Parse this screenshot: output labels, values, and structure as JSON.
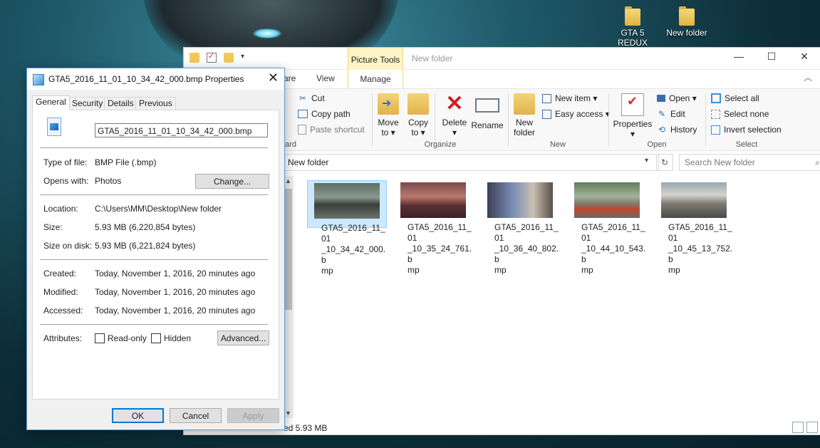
{
  "desktop": {
    "icons": [
      {
        "label": "GTA 5 REDUX"
      },
      {
        "label": "New folder"
      }
    ]
  },
  "explorer": {
    "window_title": "New folder",
    "context_tab": "Picture Tools",
    "tabs": {
      "share_partial": "are",
      "view": "View",
      "manage": "Manage"
    },
    "ribbon": {
      "clipboard": {
        "cut": "Cut",
        "copy_path": "Copy path",
        "paste_shortcut": "Paste shortcut",
        "label_partial": "ard"
      },
      "organize": {
        "move_to_line1": "Move",
        "move_to_line2": "to ▾",
        "copy_to_line1": "Copy",
        "copy_to_line2": "to ▾",
        "delete_line1": "Delete",
        "delete_line2": "▾",
        "rename": "Rename",
        "label": "Organize"
      },
      "new": {
        "new_folder_line1": "New",
        "new_folder_line2": "folder",
        "new_item": "New item ▾",
        "easy_access": "Easy access ▾",
        "label": "New"
      },
      "open": {
        "properties_line1": "Properties",
        "properties_line2": "▾",
        "open": "Open ▾",
        "edit": "Edit",
        "history": "History",
        "label": "Open"
      },
      "select": {
        "select_all": "Select all",
        "select_none": "Select none",
        "invert_selection": "Invert selection",
        "label": "Select"
      }
    },
    "address": "New folder",
    "search_placeholder": "Search New folder",
    "files": [
      {
        "name": "GTA5_2016_11_01_10_34_42_000.bmp",
        "label_l1": "GTA5_2016_11_01",
        "label_l2": "_10_34_42_000.b",
        "label_l3": "mp",
        "selected": true
      },
      {
        "name": "GTA5_2016_11_01_10_35_24_761.bmp",
        "label_l1": "GTA5_2016_11_01",
        "label_l2": "_10_35_24_761.b",
        "label_l3": "mp",
        "selected": false
      },
      {
        "name": "GTA5_2016_11_01_10_36_40_802.bmp",
        "label_l1": "GTA5_2016_11_01",
        "label_l2": "_10_36_40_802.b",
        "label_l3": "mp",
        "selected": false
      },
      {
        "name": "GTA5_2016_11_01_10_44_10_543.bmp",
        "label_l1": "GTA5_2016_11_01",
        "label_l2": "_10_44_10_543.b",
        "label_l3": "mp",
        "selected": false
      },
      {
        "name": "GTA5_2016_11_01_10_45_13_752.bmp",
        "label_l1": "GTA5_2016_11_01",
        "label_l2": "_10_45_13_752.b",
        "label_l3": "mp",
        "selected": false
      }
    ],
    "status": "ed  5.93 MB"
  },
  "properties": {
    "title": "GTA5_2016_11_01_10_34_42_000.bmp Properties",
    "tabs": [
      "General",
      "Security",
      "Details",
      "Previous Versions"
    ],
    "filename": "GTA5_2016_11_01_10_34_42_000.bmp",
    "type_label": "Type of file:",
    "type_value": "BMP File (.bmp)",
    "opens_label": "Opens with:",
    "opens_value": "Photos",
    "change_button": "Change...",
    "location_label": "Location:",
    "location_value": "C:\\Users\\MM\\Desktop\\New folder",
    "size_label": "Size:",
    "size_value": "5.93 MB (6,220,854 bytes)",
    "size_disk_label": "Size on disk:",
    "size_disk_value": "5.93 MB (6,221,824 bytes)",
    "created_label": "Created:",
    "created_value": "Today, November 1, 2016, 20 minutes ago",
    "modified_label": "Modified:",
    "modified_value": "Today, November 1, 2016, 20 minutes ago",
    "accessed_label": "Accessed:",
    "accessed_value": "Today, November 1, 2016, 20 minutes ago",
    "attributes_label": "Attributes:",
    "readonly_label": "Read-only",
    "hidden_label": "Hidden",
    "advanced_button": "Advanced...",
    "ok_button": "OK",
    "cancel_button": "Cancel",
    "apply_button": "Apply"
  },
  "colors": {
    "accent": "#0078d7",
    "selection_bg": "#cce8ff",
    "context_tab_bg": "#fef4c6",
    "delete_red": "#d21d1d"
  }
}
